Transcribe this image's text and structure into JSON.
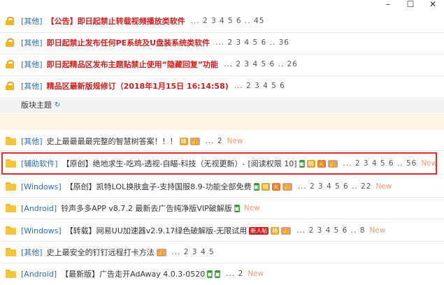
{
  "window": {
    "min": "–",
    "max": "☐",
    "close": "✕"
  },
  "sticky": [
    {
      "cat": "[其他]",
      "title": "【公告】即日起禁止转载视频播放类软件",
      "pages": "... 2 3 4 5 6 .. 45"
    },
    {
      "cat": "[其他]",
      "title": "即日起禁止发布任何PE系统及U盘装系统类软件",
      "pages": "... 2 3 4 5 6 .. 36"
    },
    {
      "cat": "[其他]",
      "title": "即日起精品区发布主题贴禁止使用“隐藏回复”功能",
      "pages": "... 2 3 4 5 6 .. 26"
    },
    {
      "cat": "[其他]",
      "title": "精品区最新版规修订（2018年1月15日 16:14:58)",
      "pages": "... 2 3 4 5 6"
    }
  ],
  "section": {
    "label": "版块主题",
    "refresh": "↻"
  },
  "threads": [
    {
      "cat": "[其他]",
      "title": "史上最最最最完整的智慧树答案！！！",
      "badges": [
        "gold",
        "hand"
      ],
      "pages": "... 2",
      "new": "New"
    },
    {
      "cat": "[辅助软件]",
      "title": "【原创】绝地求生-吃鸡-透视-自瞄-科技（无视更新）-",
      "extra": "[阅读权限 10]",
      "badges": [
        "green",
        "gold",
        "orange",
        "hand"
      ],
      "pages": "... 2 3 4 5 6 .. 56",
      "new": "New"
    },
    {
      "cat": "[Windows]",
      "title": "【原创】凯特LOL换肤盒子-支持国服8.9-功能全部免费",
      "badges": [
        "green",
        "gold",
        "orange",
        "hand"
      ],
      "pages": "... 2 3 4 5 6 .. 22",
      "new": "New"
    },
    {
      "cat": "[Android]",
      "title": "铃声多多APP v8.7.2 最新去广告纯净版VIP破解版",
      "badges": [
        "green"
      ],
      "pages": "",
      "new": "New"
    },
    {
      "cat": "[Windows]",
      "title": "【转载】网易UU加速器v2.9.17绿色破解版-无限试用",
      "badges": [
        "red",
        "gold",
        "hand"
      ],
      "pages": "... 2 3 4 5 6 .. 8",
      "new": "New"
    },
    {
      "cat": "[其他]",
      "title": "史上最安全的钉钉远程打卡方法",
      "badges": [
        "hand"
      ],
      "pages": "... 2 3 4 5",
      "new": ""
    },
    {
      "cat": "[Android]",
      "title": "【最新版】广告走开AdAway 4.0.3-0520",
      "badges": [
        "green",
        "green"
      ],
      "pages": "... 2",
      "new": "New"
    }
  ],
  "badge_labels": {
    "red": "新人帖",
    "gold": "精",
    "orange": "火"
  },
  "colors": {
    "highlight": "#e32b2b",
    "category": "#2a6fb8",
    "sticky_title": "#d21e1e",
    "new": "#f29b76"
  }
}
